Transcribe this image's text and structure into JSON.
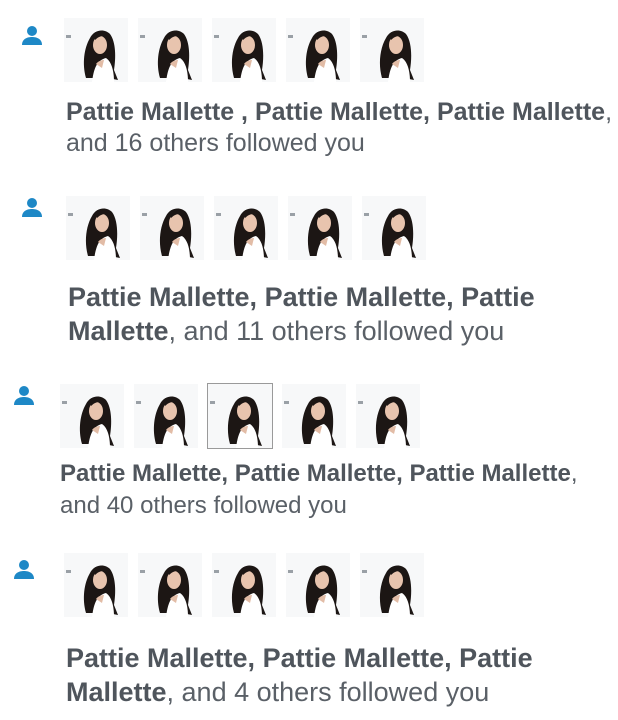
{
  "colors": {
    "icon": "#1e88c6",
    "text": "#5a6067",
    "name": "#4f555c"
  },
  "icons": {
    "follow": "person-icon",
    "avatar": "profile-photo"
  },
  "notifications": [
    {
      "names": [
        "Pattie Mallette ,",
        "Pattie Mallette,",
        "Pattie Mallette"
      ],
      "rest": ", and 16 others followed you",
      "avatar_count": 5
    },
    {
      "names": [
        "Pattie Mallette,",
        "Pattie Mallette,",
        "Pattie Mallette"
      ],
      "rest": ", and 11 others followed you",
      "avatar_count": 5
    },
    {
      "names": [
        "Pattie Mallette,",
        "Pattie Mallette,",
        "Pattie Mallette"
      ],
      "rest": ", and 40 others followed you",
      "avatar_count": 5
    },
    {
      "names": [
        "Pattie Mallette,",
        "Pattie Mallette,",
        "Pattie Mallette"
      ],
      "rest": ", and 4 others followed you",
      "avatar_count": 5
    }
  ]
}
